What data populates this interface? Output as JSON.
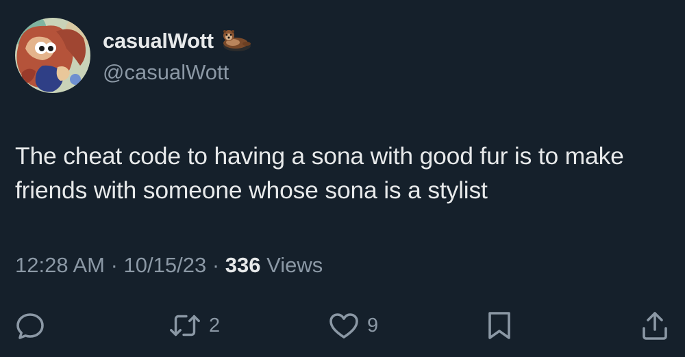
{
  "author": {
    "display_name": "casualWott",
    "handle": "@casualWott",
    "name_emoji": "otter-emoji"
  },
  "tweet": {
    "text": "The cheat code to having a sona with good fur is to make friends with someone whose sona is a stylist",
    "time": "12:28 AM",
    "date": "10/15/23",
    "separator": "·",
    "views_count": "336",
    "views_label": "Views"
  },
  "actions": {
    "reply_icon": "reply-icon",
    "retweet_icon": "retweet-icon",
    "retweet_count": "2",
    "like_icon": "heart-icon",
    "like_count": "9",
    "bookmark_icon": "bookmark-icon",
    "share_icon": "share-icon"
  },
  "colors": {
    "background": "#15202b",
    "primary_text": "#e7e9ea",
    "secondary_text": "#8b98a5"
  }
}
